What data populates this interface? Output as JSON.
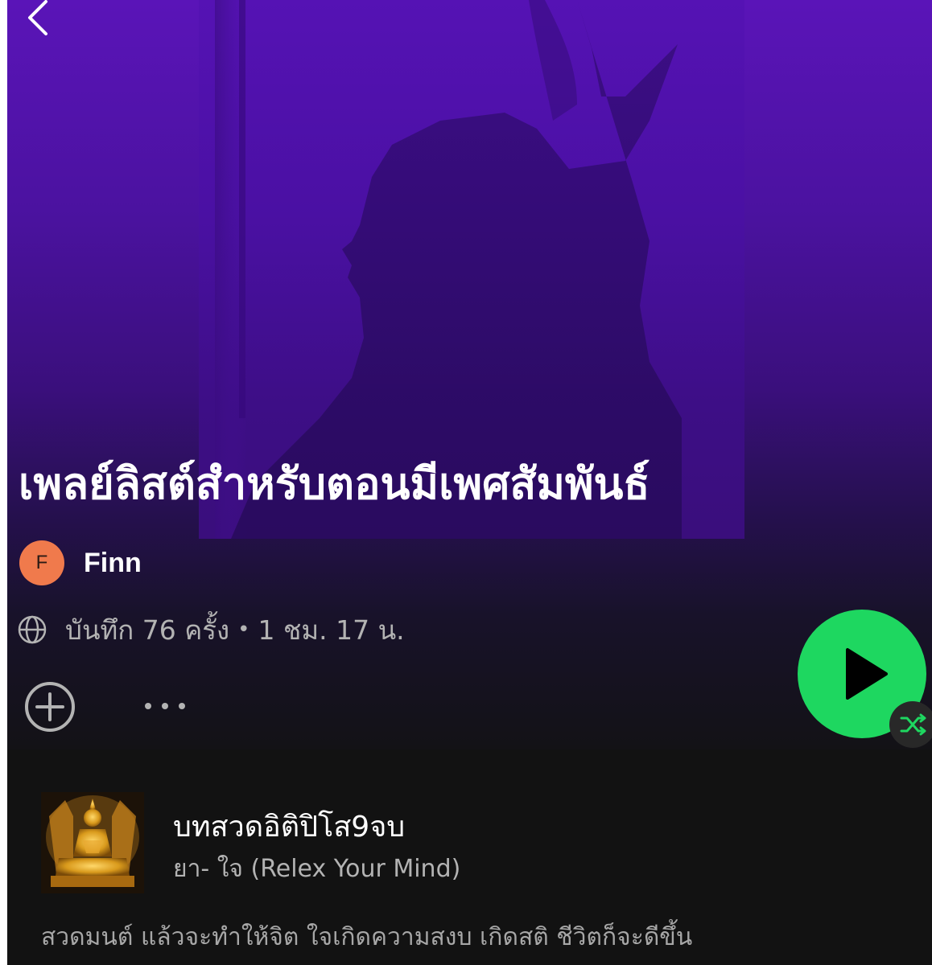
{
  "header": {
    "back_icon": "chevron-left-icon"
  },
  "playlist": {
    "title": "เพลย์ลิสต์สำหรับตอนมีเพศสัมพันธ์",
    "owner": {
      "initial": "F",
      "name": "Finn",
      "avatar_color": "#f07a4c"
    },
    "visibility_icon": "globe-icon",
    "saves": "บันทึก 76 ครั้ง",
    "separator": "•",
    "duration": "1 ชม. 17 น."
  },
  "actions": {
    "add_icon": "plus-circle-icon",
    "more_icon": "more-horizontal-icon",
    "play_icon": "play-icon",
    "shuffle_icon": "shuffle-icon",
    "accent_color": "#1ed760"
  },
  "tracks": [
    {
      "title": "บทสวดอิติปิโส9จบ",
      "artist": "ยา- ใจ (Relex Your Mind)",
      "art": "golden-buddha-statue-image"
    }
  ],
  "description": "สวดมนต์ แล้วจะทำให้จิต ใจเกิดความสงบ เกิดสติ ชีวิตก็จะดีขึ้น",
  "colors": {
    "hero_top": "#5a14b8",
    "background": "#121212",
    "text_primary": "#ffffff",
    "text_secondary": "#b3b3b3"
  }
}
